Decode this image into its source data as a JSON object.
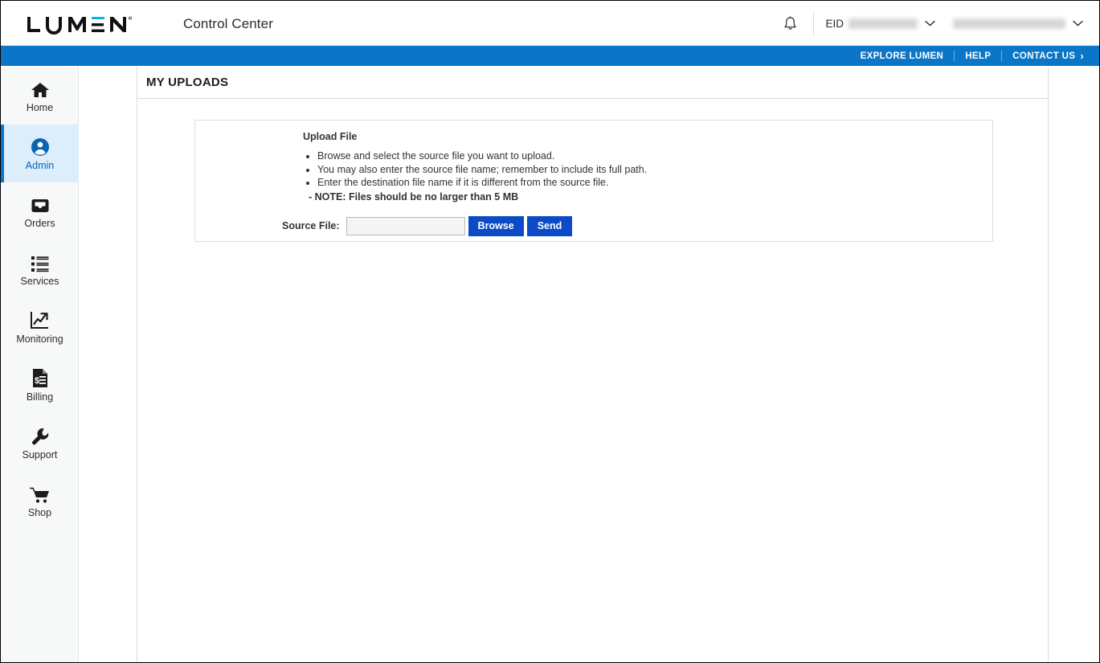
{
  "header": {
    "logo_text": "LUMEN",
    "logo_registered": "®",
    "app_title": "Control Center",
    "bell_icon": "notification-bell-icon",
    "eid_label": "EID",
    "eid_value_redacted": true,
    "account_value_redacted": true,
    "chevron_icon": "chevron-down-icon"
  },
  "utility_bar": {
    "links": [
      {
        "label": "EXPLORE LUMEN",
        "arrow": ""
      },
      {
        "label": "HELP",
        "arrow": ""
      },
      {
        "label": "CONTACT US",
        "arrow": "›"
      }
    ],
    "background_color": "#0b76c8"
  },
  "sidebar": {
    "items": [
      {
        "label": "Home",
        "icon": "home-icon",
        "active": false
      },
      {
        "label": "Admin",
        "icon": "user-circle-icon",
        "active": true
      },
      {
        "label": "Orders",
        "icon": "inbox-tray-icon",
        "active": false
      },
      {
        "label": "Services",
        "icon": "list-icon",
        "active": false
      },
      {
        "label": "Monitoring",
        "icon": "chart-trending-up-icon",
        "active": false
      },
      {
        "label": "Billing",
        "icon": "invoice-dollar-icon",
        "active": false
      },
      {
        "label": "Support",
        "icon": "wrench-icon",
        "active": false
      },
      {
        "label": "Shop",
        "icon": "shopping-cart-icon",
        "active": false
      }
    ],
    "active_background": "#dcedfb",
    "active_accent": "#0b76c8"
  },
  "main": {
    "page_title": "MY UPLOADS",
    "panel": {
      "heading": "Upload File",
      "bullets": [
        "Browse and select the source file you want to upload.",
        "You may also enter the source file name; remember to include its full path.",
        "Enter the destination file name if it is different from the source file."
      ],
      "note": "- NOTE: Files should be no larger than 5 MB",
      "form": {
        "source_file_label": "Source File:",
        "source_file_value": "",
        "source_file_placeholder": "",
        "browse_button": "Browse",
        "send_button": "Send",
        "button_color": "#0b4bc8"
      }
    }
  }
}
